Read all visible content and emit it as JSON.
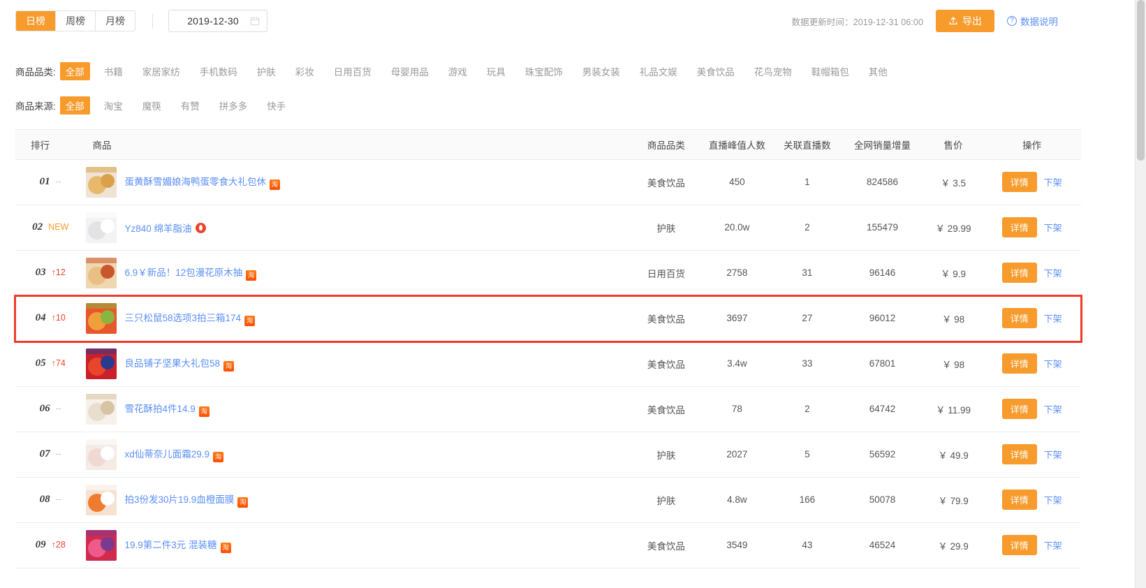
{
  "topbar": {
    "period_tabs": [
      {
        "label": "日榜",
        "active": true
      },
      {
        "label": "周榜",
        "active": false
      },
      {
        "label": "月榜",
        "active": false
      }
    ],
    "date_value": "2019-12-30",
    "update_time_label": "数据更新时间：2019-12-31 06:00",
    "export_label": "导出",
    "data_desc_label": "数据说明",
    "calendar_icon": "calendar-icon",
    "export_icon": "upload-icon",
    "help_icon": "question-circle-icon"
  },
  "filters": {
    "category": {
      "label": "商品品类:",
      "options": [
        "全部",
        "书籍",
        "家居家纺",
        "手机数码",
        "护肤",
        "彩妆",
        "日用百货",
        "母婴用品",
        "游戏",
        "玩具",
        "珠宝配饰",
        "男装女装",
        "礼品文娱",
        "美食饮品",
        "花鸟宠物",
        "鞋帽箱包",
        "其他"
      ],
      "selected": "全部"
    },
    "source": {
      "label": "商品来源:",
      "options": [
        "全部",
        "淘宝",
        "魔筷",
        "有赞",
        "拼多多",
        "快手"
      ],
      "selected": "全部"
    }
  },
  "table": {
    "columns": [
      "排行",
      "商品",
      "商品品类",
      "直播峰值人数",
      "关联直播数",
      "全网销量增量",
      "售价",
      "操作"
    ],
    "detail_label": "详情",
    "offshelf_label": "下架",
    "rows": [
      {
        "rank": "01",
        "delta": "--",
        "delta_type": "none",
        "title": "蛋黄酥雪媚娘海鸭蛋零食大礼包休",
        "source_badge": "taobao",
        "category": "美食饮品",
        "peak_viewers": "450",
        "live_count": "1",
        "sales_growth": "824586",
        "price": "￥ 3.5",
        "highlight": false,
        "thumb_colors": [
          "#efe3d6",
          "#e8b96a",
          "#d9a24a"
        ]
      },
      {
        "rank": "02",
        "delta": "NEW",
        "delta_type": "new",
        "title": "Yz840 绵羊脂油",
        "source_badge": "mofang",
        "category": "护肤",
        "peak_viewers": "20.0w",
        "live_count": "2",
        "sales_growth": "155479",
        "price": "￥ 29.99",
        "highlight": false,
        "thumb_colors": [
          "#f3f3f3",
          "#e3e3e6",
          "#ffffff"
        ]
      },
      {
        "rank": "03",
        "delta": "↑12",
        "delta_type": "up",
        "title": "6.9￥新品！12包漫花原木抽",
        "source_badge": "taobao",
        "category": "日用百货",
        "peak_viewers": "2758",
        "live_count": "31",
        "sales_growth": "96146",
        "price": "￥ 9.9",
        "highlight": false,
        "thumb_colors": [
          "#f0d7b0",
          "#e9c083",
          "#c9572e"
        ]
      },
      {
        "rank": "04",
        "delta": "↑10",
        "delta_type": "up",
        "title": "三只松鼠58选项3拍三箱174",
        "source_badge": "taobao",
        "category": "美食饮品",
        "peak_viewers": "3697",
        "live_count": "27",
        "sales_growth": "96012",
        "price": "￥ 98",
        "highlight": true,
        "thumb_colors": [
          "#e8562b",
          "#f0a03a",
          "#8ab53f"
        ]
      },
      {
        "rank": "05",
        "delta": "↑74",
        "delta_type": "up",
        "title": "良品铺子坚果大礼包58",
        "source_badge": "taobao",
        "category": "美食饮品",
        "peak_viewers": "3.4w",
        "live_count": "33",
        "sales_growth": "67801",
        "price": "￥ 98",
        "highlight": false,
        "thumb_colors": [
          "#c9202a",
          "#e8452b",
          "#2b3a8f"
        ]
      },
      {
        "rank": "06",
        "delta": "--",
        "delta_type": "none",
        "title": "雪花酥拍4件14.9",
        "source_badge": "taobao",
        "category": "美食饮品",
        "peak_viewers": "78",
        "live_count": "2",
        "sales_growth": "64742",
        "price": "￥ 11.99",
        "highlight": false,
        "thumb_colors": [
          "#f6f1ea",
          "#e9ddcd",
          "#d8c3a5"
        ]
      },
      {
        "rank": "07",
        "delta": "--",
        "delta_type": "none",
        "title": "xd仙蒂奈儿面霜29.9",
        "source_badge": "taobao",
        "category": "护肤",
        "peak_viewers": "2027",
        "live_count": "5",
        "sales_growth": "56592",
        "price": "￥ 49.9",
        "highlight": false,
        "thumb_colors": [
          "#f4eae6",
          "#efd9d2",
          "#ffffff"
        ]
      },
      {
        "rank": "08",
        "delta": "--",
        "delta_type": "none",
        "title": "拍3份发30片19.9血橙面膜",
        "source_badge": "taobao",
        "category": "护肤",
        "peak_viewers": "4.8w",
        "live_count": "166",
        "sales_growth": "50078",
        "price": "￥ 79.9",
        "highlight": false,
        "thumb_colors": [
          "#f5e2d3",
          "#ef7b2e",
          "#ffffff"
        ]
      },
      {
        "rank": "09",
        "delta": "↑28",
        "delta_type": "up",
        "title": "19.9第二件3元 混装糖",
        "source_badge": "taobao",
        "category": "美食饮品",
        "peak_viewers": "3549",
        "live_count": "43",
        "sales_growth": "46524",
        "price": "￥ 29.9",
        "highlight": false,
        "thumb_colors": [
          "#d12a4f",
          "#ef5a8a",
          "#7a3a8f"
        ]
      }
    ]
  },
  "colors": {
    "accent": "#f79b2c",
    "link": "#5b8ff9",
    "price": "#f2590f",
    "highlight_border": "#ef3b2b",
    "up": "#e8452b"
  }
}
